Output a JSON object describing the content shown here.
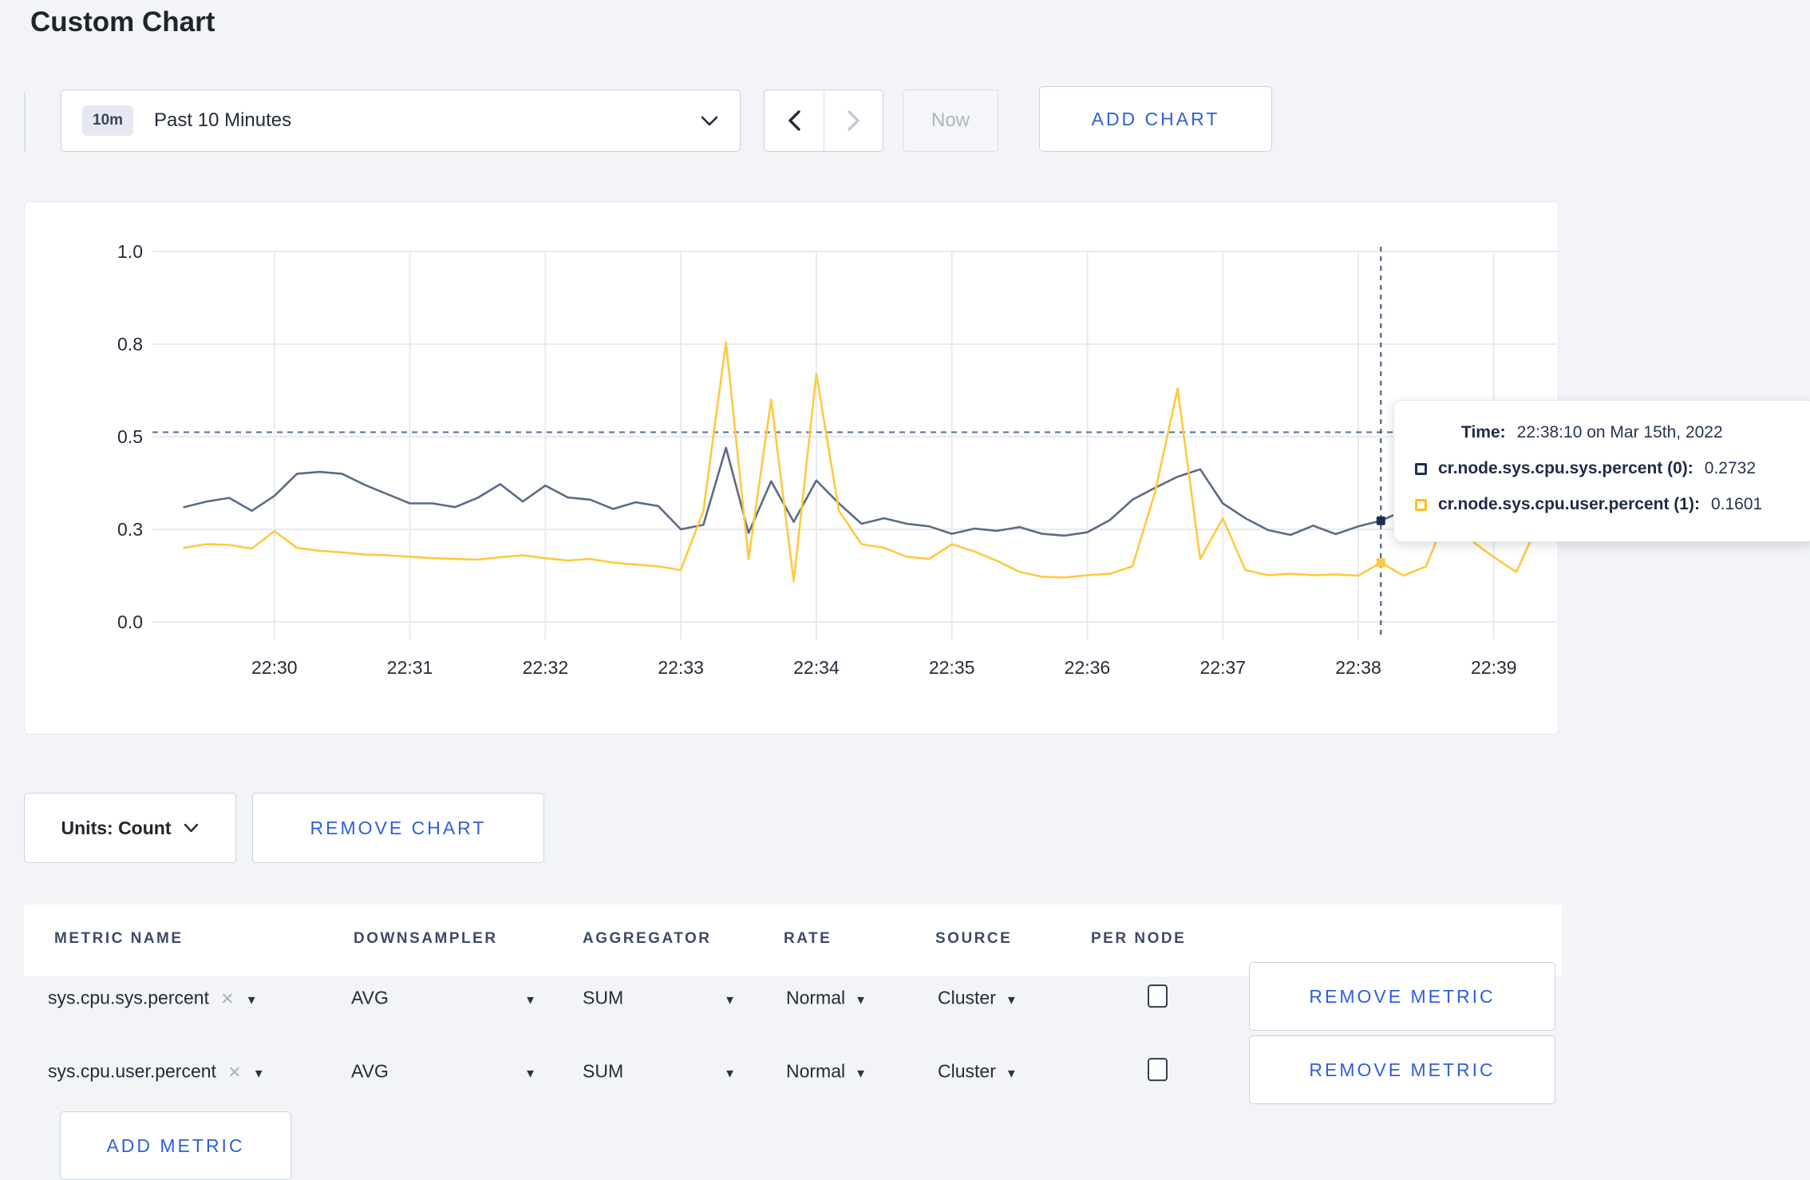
{
  "page": {
    "title": "Custom Chart"
  },
  "toolbar": {
    "timeframe_badge": "10m",
    "timeframe_label": "Past 10 Minutes",
    "now_label": "Now",
    "add_chart_label": "ADD CHART",
    "icons": [
      "chevron-down-icon",
      "chevron-left-icon",
      "chevron-right-icon"
    ]
  },
  "chart": {
    "units_label": "Units: Count",
    "remove_chart_label": "REMOVE CHART",
    "tooltip": {
      "time_label": "Time:",
      "time_value": "22:38:10 on Mar 15th, 2022",
      "rows": [
        {
          "swatch_color": "#1e2f55",
          "label": "cr.node.sys.cpu.sys.percent (0):",
          "value": "0.2732"
        },
        {
          "swatch_color": "#ffc213",
          "label": "cr.node.sys.cpu.user.percent (1):",
          "value": "0.1601"
        }
      ]
    }
  },
  "chart_data": {
    "type": "line",
    "x_start_time": "22:29:20",
    "x_step_seconds": 10,
    "x_domain": [
      -14,
      608
    ],
    "ylim": [
      0,
      1
    ],
    "grid": true,
    "y_ticks": [
      {
        "v": 0.0,
        "label": "0.0"
      },
      {
        "v": 0.25,
        "label": "0.3"
      },
      {
        "v": 0.5,
        "label": "0.5"
      },
      {
        "v": 0.75,
        "label": "0.8"
      },
      {
        "v": 1.0,
        "label": "1.0"
      }
    ],
    "x_ticks": [
      {
        "s": 40,
        "label": "22:30"
      },
      {
        "s": 100,
        "label": "22:31"
      },
      {
        "s": 160,
        "label": "22:32"
      },
      {
        "s": 220,
        "label": "22:33"
      },
      {
        "s": 280,
        "label": "22:34"
      },
      {
        "s": 340,
        "label": "22:35"
      },
      {
        "s": 400,
        "label": "22:36"
      },
      {
        "s": 460,
        "label": "22:37"
      },
      {
        "s": 520,
        "label": "22:38"
      },
      {
        "s": 580,
        "label": "22:39"
      }
    ],
    "guide_value": 0.512,
    "series": [
      {
        "name": "cr.node.sys.cpu.sys.percent",
        "color": "#5b6b87",
        "values": [
          0.31,
          0.325,
          0.335,
          0.3,
          0.34,
          0.4,
          0.405,
          0.4,
          0.37,
          0.345,
          0.32,
          0.32,
          0.31,
          0.335,
          0.372,
          0.325,
          0.368,
          0.336,
          0.33,
          0.305,
          0.323,
          0.313,
          0.25,
          0.262,
          0.47,
          0.24,
          0.38,
          0.27,
          0.382,
          0.32,
          0.265,
          0.28,
          0.265,
          0.258,
          0.238,
          0.252,
          0.246,
          0.256,
          0.238,
          0.233,
          0.242,
          0.275,
          0.33,
          0.362,
          0.392,
          0.412,
          0.32,
          0.28,
          0.248,
          0.235,
          0.26,
          0.237,
          0.258,
          0.2732,
          0.3,
          0.31,
          0.3,
          0.305,
          0.3,
          0.302,
          0.298
        ]
      },
      {
        "name": "cr.node.sys.cpu.user.percent",
        "color": "#ffc940",
        "values": [
          0.2,
          0.21,
          0.208,
          0.198,
          0.245,
          0.2,
          0.192,
          0.188,
          0.182,
          0.18,
          0.176,
          0.172,
          0.17,
          0.168,
          0.175,
          0.18,
          0.172,
          0.166,
          0.17,
          0.16,
          0.155,
          0.15,
          0.14,
          0.3,
          0.755,
          0.17,
          0.6,
          0.11,
          0.67,
          0.3,
          0.21,
          0.2,
          0.176,
          0.17,
          0.21,
          0.19,
          0.165,
          0.135,
          0.122,
          0.12,
          0.126,
          0.13,
          0.15,
          0.35,
          0.63,
          0.17,
          0.28,
          0.14,
          0.126,
          0.13,
          0.126,
          0.128,
          0.125,
          0.1601,
          0.125,
          0.15,
          0.3,
          0.22,
          0.175,
          0.135,
          0.27
        ]
      }
    ],
    "crosshair": {
      "seconds": 530,
      "time": "22:38:10",
      "markers": [
        {
          "series": 0,
          "value": 0.2732,
          "color": "#1e2f55"
        },
        {
          "series": 1,
          "value": 0.1601,
          "color": "#ffc940"
        }
      ]
    }
  },
  "metrics_table": {
    "headers": [
      "METRIC NAME",
      "DOWNSAMPLER",
      "AGGREGATOR",
      "RATE",
      "SOURCE",
      "PER NODE"
    ],
    "remove_metric_label": "REMOVE METRIC",
    "add_metric_label": "ADD METRIC",
    "rows": [
      {
        "metric": "sys.cpu.sys.percent",
        "downsampler": "AVG",
        "aggregator": "SUM",
        "rate": "Normal",
        "source": "Cluster",
        "per_node_checked": false
      },
      {
        "metric": "sys.cpu.user.percent",
        "downsampler": "AVG",
        "aggregator": "SUM",
        "rate": "Normal",
        "source": "Cluster",
        "per_node_checked": false
      }
    ]
  }
}
